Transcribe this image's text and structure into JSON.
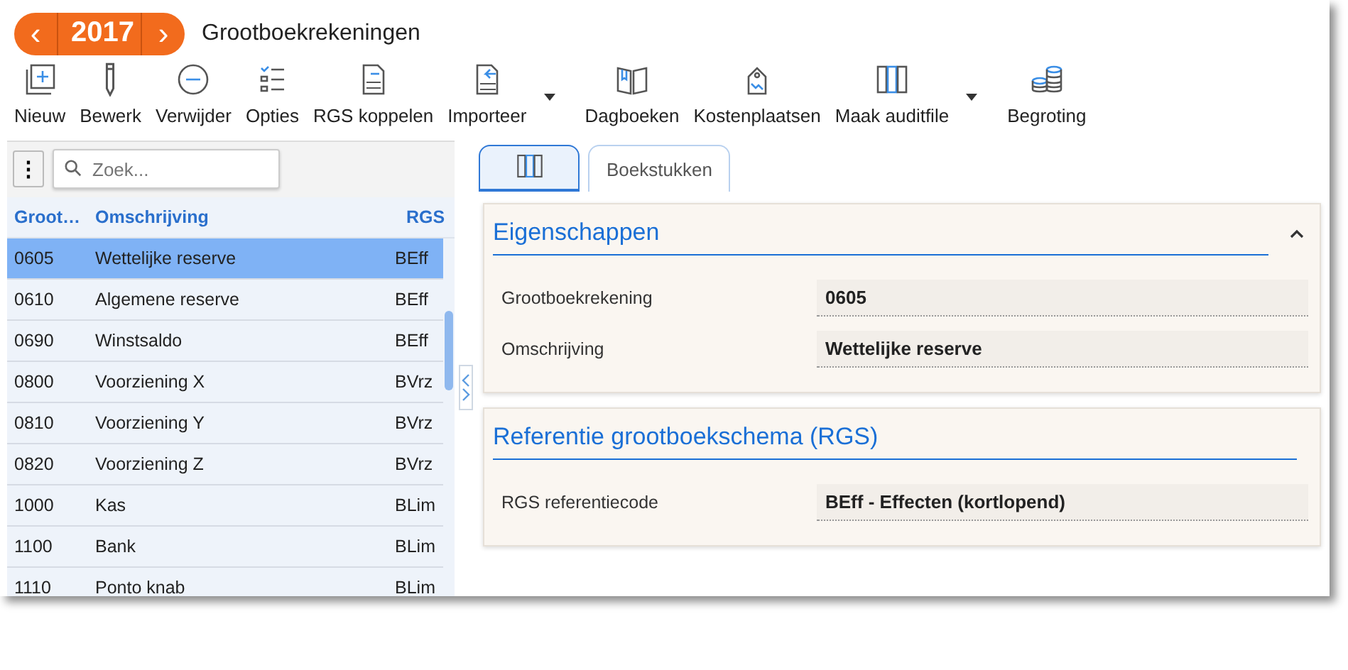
{
  "year_picker": {
    "prev": "‹",
    "year": "2017",
    "next": "›"
  },
  "title": "Grootboekrekeningen",
  "toolbar": [
    {
      "label": "Nieuw",
      "dropdown": false
    },
    {
      "label": "Bewerk",
      "dropdown": false
    },
    {
      "label": "Verwijder",
      "dropdown": false
    },
    {
      "label": "Opties",
      "dropdown": false
    },
    {
      "label": "RGS koppelen",
      "dropdown": false
    },
    {
      "label": "Importeer",
      "dropdown": true
    },
    {
      "label": "Dagboeken",
      "dropdown": false
    },
    {
      "label": "Kostenplaatsen",
      "dropdown": false
    },
    {
      "label": "Maak auditfile",
      "dropdown": true
    },
    {
      "label": "Begroting",
      "dropdown": false
    }
  ],
  "list": {
    "menu_button": "⋮",
    "search": {
      "placeholder": "Zoek..."
    },
    "columns": [
      "Groot…",
      "Omschrijving",
      "RGS"
    ],
    "rows": [
      {
        "cells": [
          "0605",
          "Wettelijke reserve",
          "BEff"
        ],
        "selected": true
      },
      {
        "cells": [
          "0610",
          "Algemene reserve",
          "BEff"
        ],
        "selected": false
      },
      {
        "cells": [
          "0690",
          "Winstsaldo",
          "BEff"
        ],
        "selected": false
      },
      {
        "cells": [
          "0800",
          "Voorziening X",
          "BVrz"
        ],
        "selected": false
      },
      {
        "cells": [
          "0810",
          "Voorziening Y",
          "BVrz"
        ],
        "selected": false
      },
      {
        "cells": [
          "0820",
          "Voorziening Z",
          "BVrz"
        ],
        "selected": false
      },
      {
        "cells": [
          "1000",
          "Kas",
          "BLim"
        ],
        "selected": false
      },
      {
        "cells": [
          "1100",
          "Bank",
          "BLim"
        ],
        "selected": false
      },
      {
        "cells": [
          "1110",
          "Ponto knab",
          "BLim"
        ],
        "selected": false
      }
    ]
  },
  "tabs": [
    {
      "kind": "icon",
      "selected": true
    },
    {
      "kind": "text",
      "label": "Boekstukken",
      "selected": false
    }
  ],
  "cards": [
    {
      "title": "Eigenschappen",
      "expanded": true,
      "fields": [
        {
          "label": "Grootboekrekening",
          "value": "0605"
        },
        {
          "label": "Omschrijving",
          "value": "Wettelijke reserve"
        }
      ]
    },
    {
      "title": "Referentie grootboekschema (RGS)",
      "fields": [
        {
          "label": "RGS referentiecode",
          "value": "BEff - Effecten (kortlopend)"
        }
      ]
    }
  ]
}
